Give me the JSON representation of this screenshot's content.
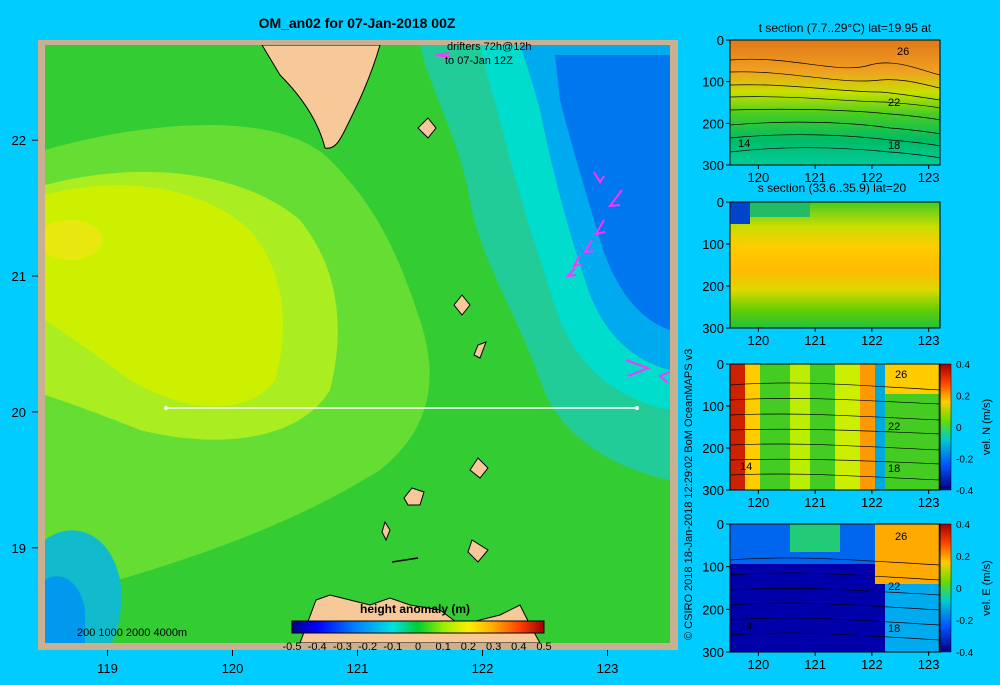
{
  "colors": {
    "background": "#00ccff",
    "land": "#f7c898",
    "drifter": "#ff33ff",
    "section_line": "#ffffff"
  },
  "main_map": {
    "title": "OM_an02 for 07-Jan-2018 00Z",
    "drifter_note_line1": "drifters 72h@12h",
    "drifter_note_line2": "to 07-Jan 12Z",
    "x_ticks": [
      "119",
      "120",
      "121",
      "122",
      "123"
    ],
    "y_ticks": [
      "22",
      "21",
      "20",
      "19"
    ],
    "depth_legend": "200  1000  2000  4000m",
    "colorbar_title": "height anomaly (m)",
    "colorbar_ticks": [
      "-0.5",
      "-0.4",
      "-0.3",
      "-0.2",
      "-0.1",
      "0",
      "0.1",
      "0.2",
      "0.3",
      "0.4",
      "0.5"
    ]
  },
  "credit": "© CSIRO 2018   18-Jan-2018 12:29:02 BoM OceanMAPS v3",
  "sections": {
    "temperature": {
      "title": "t section (7.7..29°C) lat=19.95 at",
      "contour_labels": [
        "26",
        "22",
        "18",
        "14"
      ]
    },
    "salinity": {
      "title": "s section (33.6..35.9) lat=20"
    },
    "vel_n": {
      "colorbar_label": "vel. N (m/s)",
      "contour_labels": [
        "26",
        "22",
        "18",
        "14"
      ]
    },
    "vel_e": {
      "colorbar_label": "vel. E (m/s)",
      "contour_labels": [
        "26",
        "22",
        "18",
        "14"
      ]
    },
    "x_ticks": [
      "120",
      "121",
      "122",
      "123"
    ],
    "y_ticks": [
      "0",
      "100",
      "200",
      "300"
    ],
    "velocity_ticks": [
      "0.4",
      "0.2",
      "0",
      "-0.2",
      "-0.4"
    ]
  },
  "chart_data": [
    {
      "type": "heatmap",
      "title": "OM_an02 for 07-Jan-2018 00Z",
      "xlim": [
        118.5,
        123.5
      ],
      "ylim": [
        18.3,
        22.7
      ],
      "x_ticks": [
        119,
        120,
        121,
        122,
        123
      ],
      "y_ticks": [
        19,
        20,
        21,
        22
      ],
      "colorbar": {
        "label": "height anomaly (m)",
        "range": [
          -0.5,
          0.5
        ],
        "ticks": [
          -0.5,
          -0.4,
          -0.3,
          -0.2,
          -0.1,
          0,
          0.1,
          0.2,
          0.3,
          0.4,
          0.5
        ]
      },
      "section_line": {
        "lat": 20,
        "lon": [
          119.5,
          123.2
        ]
      },
      "field_summary": [
        {
          "region": "west (lon 119–120, lat 20.5–21.5)",
          "height_anomaly": 0.25
        },
        {
          "region": "central (lon 120.5–121.5)",
          "height_anomaly": 0.1
        },
        {
          "region": "east eddy (lon 122.7, lat 21.8)",
          "height_anomaly": -0.3
        },
        {
          "region": "southwest (lon 118.8, lat 18.5)",
          "height_anomaly": -0.1
        }
      ]
    },
    {
      "type": "heatmap",
      "title": "t section (7.7..29°C) lat=19.95 at",
      "xlim": [
        119.5,
        123.2
      ],
      "ylim": [
        300,
        0
      ],
      "x_ticks": [
        120,
        121,
        122,
        123
      ],
      "y_ticks": [
        0,
        100,
        200,
        300
      ],
      "contours": [
        26,
        22,
        18,
        14
      ]
    },
    {
      "type": "heatmap",
      "title": "s section (33.6..35.9) lat=20",
      "xlim": [
        119.5,
        123.2
      ],
      "ylim": [
        300,
        0
      ],
      "x_ticks": [
        120,
        121,
        122,
        123
      ],
      "y_ticks": [
        0,
        100,
        200,
        300
      ]
    },
    {
      "type": "heatmap",
      "xlim": [
        119.5,
        123.2
      ],
      "ylim": [
        300,
        0
      ],
      "x_ticks": [
        120,
        121,
        122,
        123
      ],
      "y_ticks": [
        0,
        100,
        200,
        300
      ],
      "colorbar": {
        "label": "vel. N (m/s)",
        "range": [
          -0.4,
          0.4
        ],
        "ticks": [
          0.4,
          0.2,
          0,
          -0.2,
          -0.4
        ]
      },
      "contours": [
        26,
        22,
        18,
        14
      ]
    },
    {
      "type": "heatmap",
      "xlim": [
        119.5,
        123.2
      ],
      "ylim": [
        300,
        0
      ],
      "x_ticks": [
        120,
        121,
        122,
        123
      ],
      "y_ticks": [
        0,
        100,
        200,
        300
      ],
      "colorbar": {
        "label": "vel. E (m/s)",
        "range": [
          -0.4,
          0.4
        ],
        "ticks": [
          0.4,
          0.2,
          0,
          -0.2,
          -0.4
        ]
      },
      "contours": [
        26,
        22,
        18,
        14
      ]
    }
  ]
}
